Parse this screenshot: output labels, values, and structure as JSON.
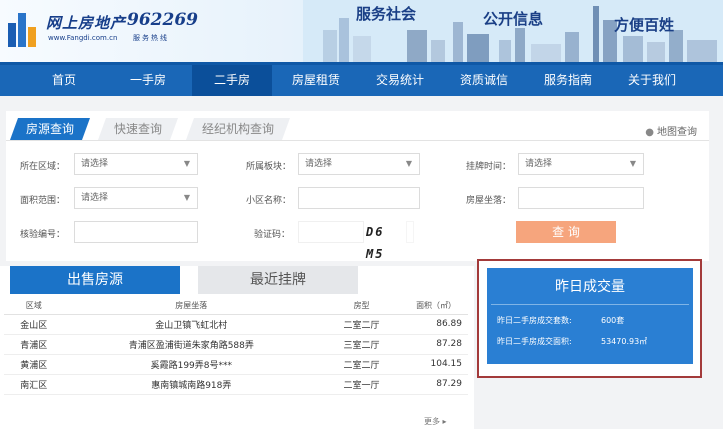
{
  "header": {
    "logo_text": "网上房地产",
    "logo_url": "www.Fangdi.com.cn",
    "hotline": "962269",
    "hotline_sub": "服务热线",
    "slogans": [
      "服务社会",
      "公开信息",
      "方便百姓"
    ]
  },
  "nav": {
    "items": [
      {
        "label": "首页"
      },
      {
        "label": "一手房"
      },
      {
        "label": "二手房"
      },
      {
        "label": "房屋租赁"
      },
      {
        "label": "交易统计"
      },
      {
        "label": "资质诚信"
      },
      {
        "label": "服务指南"
      },
      {
        "label": "关于我们"
      }
    ],
    "active_index": 2
  },
  "search": {
    "tabs": [
      "房源查询",
      "快速查询",
      "经纪机构查询"
    ],
    "map_link": "地图查询",
    "fields": {
      "region_label": "所在区域：",
      "region_value": "请选择",
      "plate_label": "所属板块：",
      "plate_value": "请选择",
      "listed_time_label": "挂牌时间：",
      "listed_time_value": "请选择",
      "area_range_label": "面积范围：",
      "area_range_value": "请选择",
      "community_label": "小区名称：",
      "community_value": "",
      "location_label": "房屋坐落：",
      "location_value": "",
      "verify_no_label": "核验编号：",
      "verify_no_value": "",
      "captcha_label": "验证码：",
      "captcha_value": "",
      "captcha_image": "D6 M5"
    },
    "query_button": "查 询"
  },
  "listings": {
    "tabs": [
      "出售房源",
      "最近挂牌"
    ],
    "columns": [
      "区域",
      "房屋坐落",
      "房型",
      "面积（㎡）"
    ],
    "rows": [
      {
        "area": "金山区",
        "address": "金山卫镇飞虹北村",
        "type": "二室二厅",
        "size": "86.89"
      },
      {
        "area": "青浦区",
        "address": "青浦区盈浦街道朱家角路588弄",
        "type": "三室二厅",
        "size": "87.28"
      },
      {
        "area": "黄浦区",
        "address": "奚霞路199弄8号***",
        "type": "二室二厅",
        "size": "104.15"
      },
      {
        "area": "南汇区",
        "address": "惠南镇城南路918弄",
        "type": "二室一厅",
        "size": "87.29"
      }
    ],
    "more": "更多 ▸"
  },
  "yesterday": {
    "title": "昨日成交量",
    "count_label": "昨日二手房成交套数:",
    "count_value": "600套",
    "area_label": "昨日二手房成交面积:",
    "area_value": "53470.93㎡"
  },
  "colors": {
    "nav_bg": "#1a67b7",
    "accent_blue": "#1b73c8",
    "query_button": "#f6a57d",
    "highlight_border": "#a33a3a"
  }
}
